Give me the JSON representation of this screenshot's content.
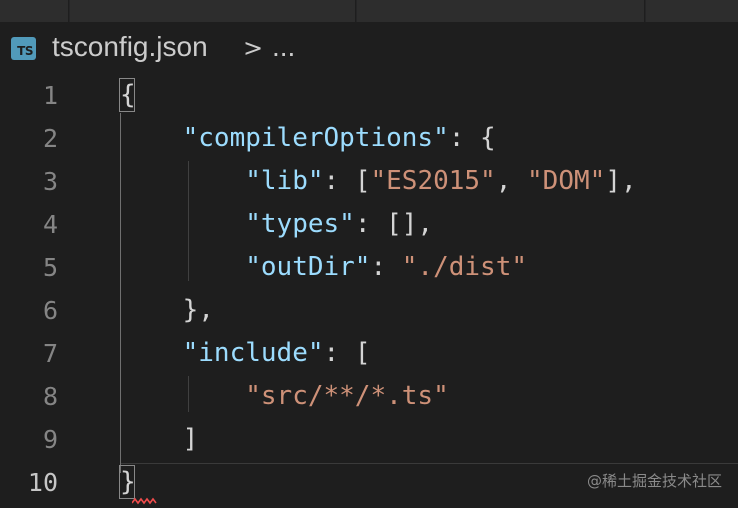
{
  "breadcrumb": {
    "file_icon": "TS",
    "file_name": "tsconfig.json",
    "separator": ">",
    "more": "..."
  },
  "editor": {
    "lines": [
      {
        "num": "1",
        "parts": [
          {
            "t": "p",
            "v": "{"
          }
        ]
      },
      {
        "num": "2",
        "parts": [
          {
            "t": "p",
            "v": "    "
          },
          {
            "t": "k",
            "v": "\"compilerOptions\""
          },
          {
            "t": "p",
            "v": ": {"
          }
        ]
      },
      {
        "num": "3",
        "parts": [
          {
            "t": "p",
            "v": "        "
          },
          {
            "t": "k",
            "v": "\"lib\""
          },
          {
            "t": "p",
            "v": ": ["
          },
          {
            "t": "s",
            "v": "\"ES2015\""
          },
          {
            "t": "p",
            "v": ", "
          },
          {
            "t": "s",
            "v": "\"DOM\""
          },
          {
            "t": "p",
            "v": "],"
          }
        ]
      },
      {
        "num": "4",
        "parts": [
          {
            "t": "p",
            "v": "        "
          },
          {
            "t": "k",
            "v": "\"types\""
          },
          {
            "t": "p",
            "v": ": [],"
          }
        ]
      },
      {
        "num": "5",
        "parts": [
          {
            "t": "p",
            "v": "        "
          },
          {
            "t": "k",
            "v": "\"outDir\""
          },
          {
            "t": "p",
            "v": ": "
          },
          {
            "t": "s",
            "v": "\"./dist\""
          }
        ]
      },
      {
        "num": "6",
        "parts": [
          {
            "t": "p",
            "v": "    },"
          }
        ]
      },
      {
        "num": "7",
        "parts": [
          {
            "t": "p",
            "v": "    "
          },
          {
            "t": "k",
            "v": "\"include\""
          },
          {
            "t": "p",
            "v": ": ["
          }
        ]
      },
      {
        "num": "8",
        "parts": [
          {
            "t": "p",
            "v": "        "
          },
          {
            "t": "s",
            "v": "\"src/**/*.ts\""
          }
        ]
      },
      {
        "num": "9",
        "parts": [
          {
            "t": "p",
            "v": "    ]"
          }
        ]
      },
      {
        "num": "10",
        "parts": [
          {
            "t": "p",
            "v": "}"
          }
        ]
      }
    ],
    "active_line": "10"
  },
  "watermark": "@稀土掘金技术社区",
  "colors": {
    "background": "#1e1e1e",
    "property_key": "#9cdcfe",
    "string_value": "#ce9178",
    "punctuation": "#d4d4d4",
    "line_number": "#858585",
    "ts_icon": "#519aba"
  }
}
